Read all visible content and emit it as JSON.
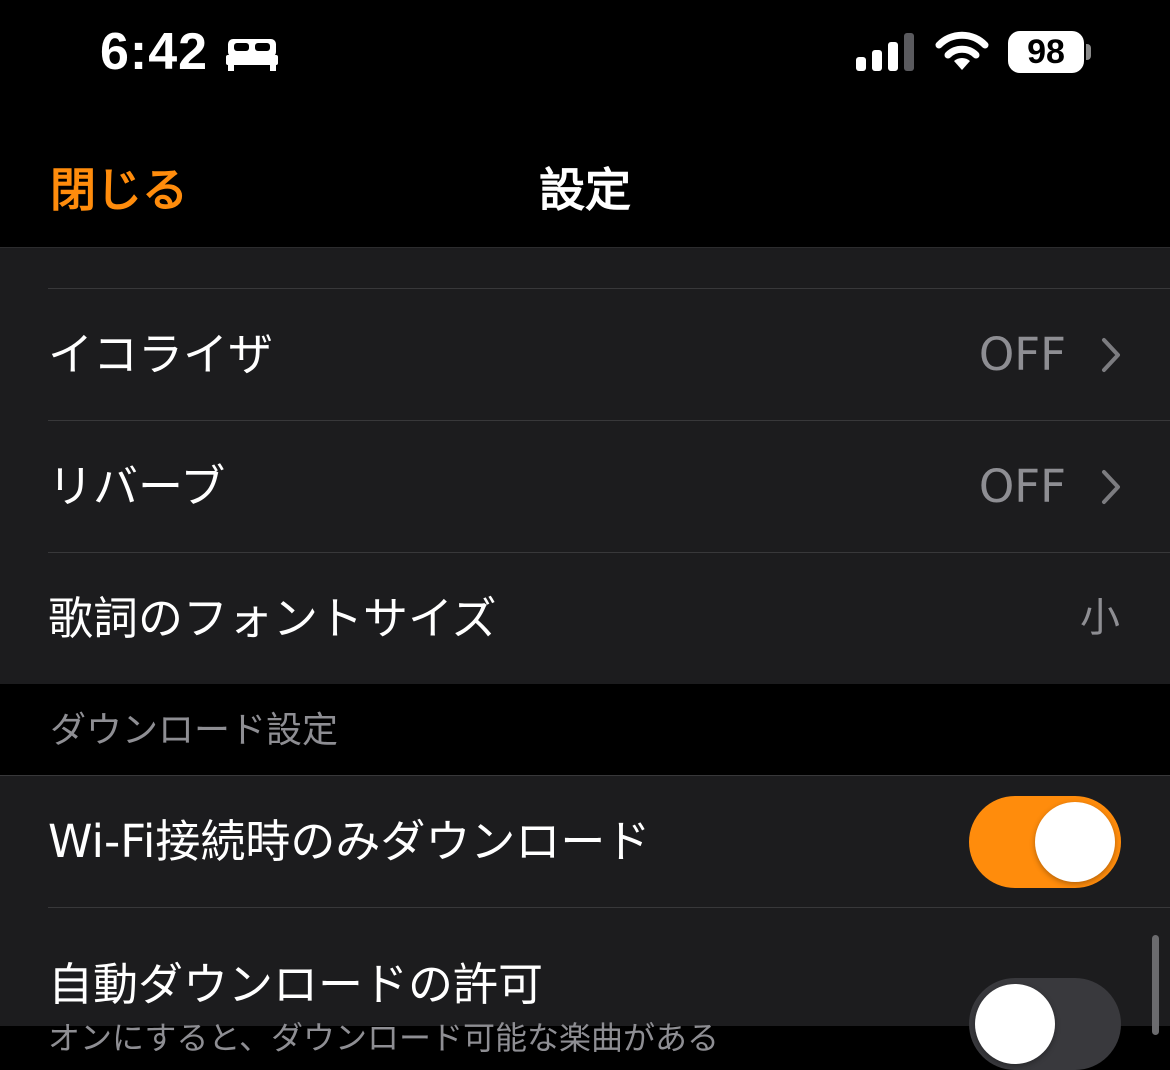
{
  "status_bar": {
    "time": "6:42",
    "focus_icon": "bed-icon",
    "signal_icon": "cellular-signal-icon",
    "wifi_icon": "wifi-icon",
    "battery_level": "98"
  },
  "nav": {
    "close_label": "閉じる",
    "title": "設定",
    "accent_color": "#ff8c0c"
  },
  "settings": {
    "equalizer": {
      "label": "イコライザ",
      "value": "OFF"
    },
    "reverb": {
      "label": "リバーブ",
      "value": "OFF"
    },
    "lyrics_font_size": {
      "label": "歌詞のフォントサイズ",
      "value": "小"
    }
  },
  "download_section": {
    "header": "ダウンロード設定",
    "wifi_only": {
      "label": "Wi-Fi接続時のみダウンロード",
      "enabled": true
    },
    "auto_download": {
      "label": "自動ダウンロードの許可",
      "subtitle": "オンにすると、ダウンロード可能な楽曲がある",
      "enabled": false
    }
  }
}
